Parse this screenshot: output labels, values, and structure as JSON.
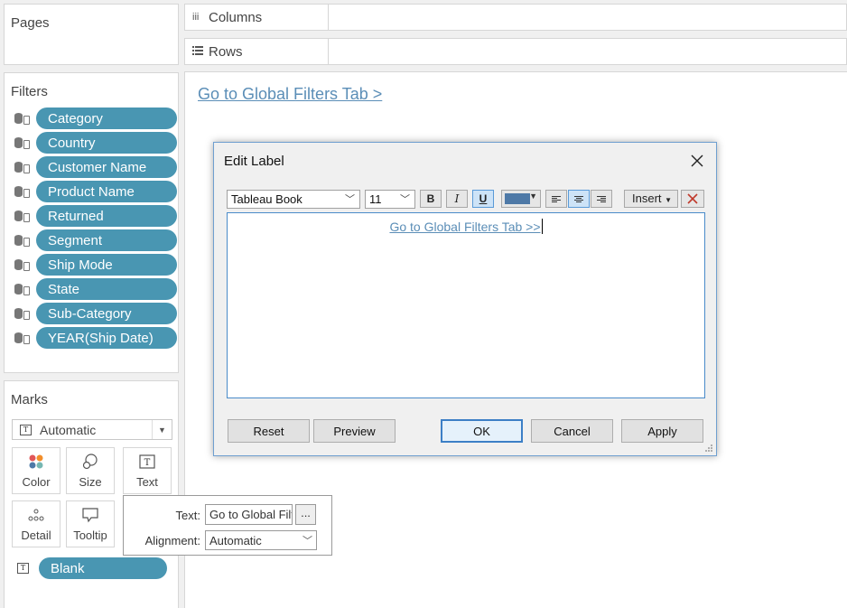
{
  "panels": {
    "pages_title": "Pages",
    "filters_title": "Filters",
    "marks_title": "Marks"
  },
  "shelves": {
    "columns_icon": "iii",
    "columns_label": "Columns",
    "rows_icon": "list-icon",
    "rows_label": "Rows"
  },
  "filters": [
    {
      "label": "Category"
    },
    {
      "label": "Country"
    },
    {
      "label": "Customer Name"
    },
    {
      "label": "Product Name"
    },
    {
      "label": "Returned"
    },
    {
      "label": "Segment"
    },
    {
      "label": "Ship Mode"
    },
    {
      "label": "State"
    },
    {
      "label": "Sub-Category"
    },
    {
      "label": "YEAR(Ship Date)"
    }
  ],
  "marks": {
    "type": "Automatic",
    "buttons": {
      "color": "Color",
      "size": "Size",
      "text": "Text",
      "detail": "Detail",
      "tooltip": "Tooltip"
    },
    "blank_pill": "Blank"
  },
  "canvas": {
    "link_text": "Go to Global Filters Tab >"
  },
  "text_popup": {
    "text_label": "Text:",
    "text_value": "Go to Global Filters Tab >>",
    "dots": "...",
    "alignment_label": "Alignment:",
    "alignment_value": "Automatic"
  },
  "dialog": {
    "title": "Edit Label",
    "font": "Tableau Book",
    "size": "11",
    "bold": "B",
    "italic": "I",
    "underline": "U",
    "text_color": "#4e79a7",
    "insert": "Insert",
    "editor_text": "Go to Global Filters Tab >>",
    "buttons": {
      "reset": "Reset",
      "preview": "Preview",
      "ok": "OK",
      "cancel": "Cancel",
      "apply": "Apply"
    }
  },
  "colors": {
    "pill": "#4996b2",
    "link": "#5b8eb7",
    "dialog_border": "#6f9fd0"
  }
}
